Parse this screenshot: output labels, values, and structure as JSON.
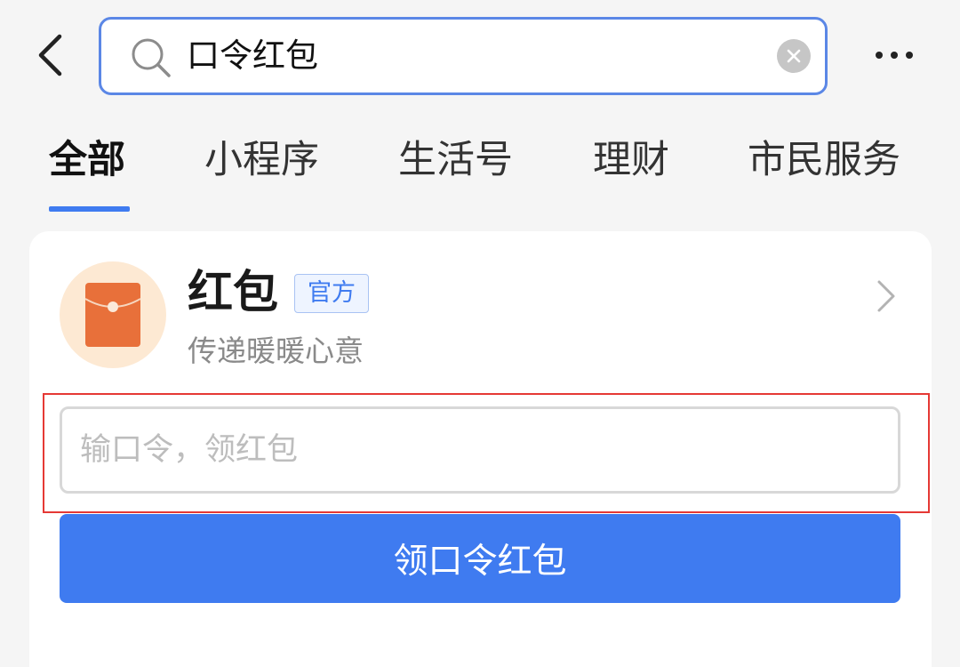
{
  "search": {
    "query": "口令红包",
    "back_icon": "chevron-left-icon",
    "search_icon": "search-icon",
    "clear_icon": "close-circle-icon",
    "more_icon": "more-horizontal-icon"
  },
  "tabs": [
    {
      "label": "全部",
      "active": true
    },
    {
      "label": "小程序",
      "active": false
    },
    {
      "label": "生活号",
      "active": false
    },
    {
      "label": "理财",
      "active": false
    },
    {
      "label": "市民服务",
      "active": false
    }
  ],
  "result": {
    "name": "红包",
    "badge": "官方",
    "subtitle": "传递暖暖心意",
    "icon": "red-envelope-icon",
    "input_placeholder": "输口令，领红包",
    "button_label": "领口令红包"
  },
  "colors": {
    "accent": "#3f7bf0",
    "envelope": "#e8703a",
    "avatar_bg": "#fde9d3",
    "highlight_border": "#e53935"
  }
}
